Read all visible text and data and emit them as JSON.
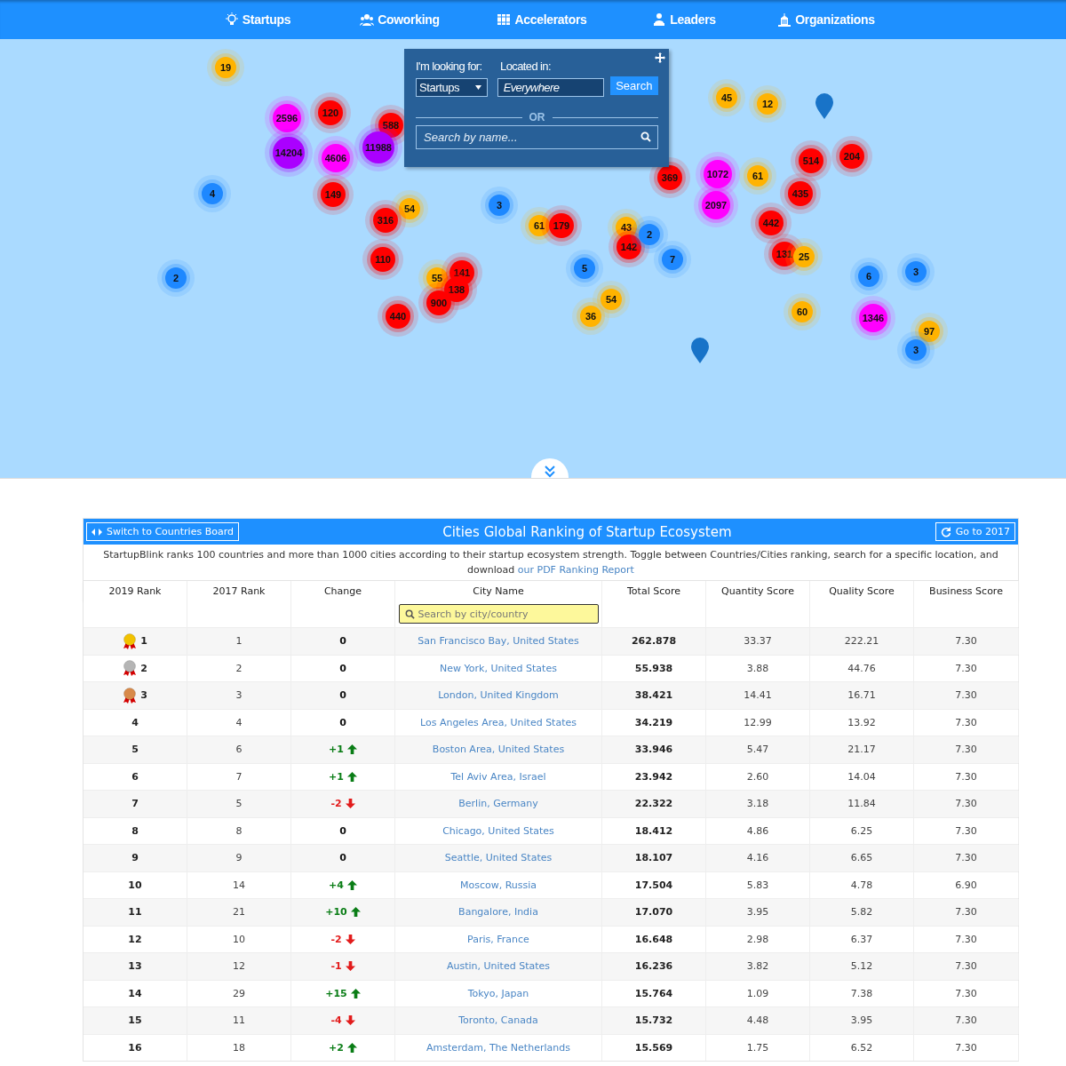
{
  "nav": [
    {
      "label": "Startups"
    },
    {
      "label": "Coworking"
    },
    {
      "label": "Accelerators"
    },
    {
      "label": "Leaders"
    },
    {
      "label": "Organizations"
    }
  ],
  "map": {
    "clusters": [
      {
        "count": "19",
        "color": "#ffb300"
      },
      {
        "count": "2596",
        "color": "#ff00ff"
      },
      {
        "count": "120",
        "color": "#ff0000"
      },
      {
        "count": "588",
        "color": "#ff0000"
      },
      {
        "count": "14204",
        "color": "#aa00ff"
      },
      {
        "count": "4606",
        "color": "#ff00ff"
      },
      {
        "count": "11988",
        "color": "#aa00ff"
      },
      {
        "count": "4",
        "color": "#1e88ff"
      },
      {
        "count": "149",
        "color": "#ff0000"
      },
      {
        "count": "54",
        "color": "#ffb300"
      },
      {
        "count": "316",
        "color": "#ff0000"
      },
      {
        "count": "3",
        "color": "#1e88ff"
      },
      {
        "count": "110",
        "color": "#ff0000"
      },
      {
        "count": "55",
        "color": "#ffb300"
      },
      {
        "count": "141",
        "color": "#ff0000"
      },
      {
        "count": "138",
        "color": "#ff0000"
      },
      {
        "count": "900",
        "color": "#ff0000"
      },
      {
        "count": "440",
        "color": "#ff0000"
      },
      {
        "count": "45",
        "color": "#ffb300"
      },
      {
        "count": "12",
        "color": "#ffb300"
      },
      {
        "count": "369",
        "color": "#ff0000"
      },
      {
        "count": "1072",
        "color": "#ff00ff"
      },
      {
        "count": "2097",
        "color": "#ff00ff"
      },
      {
        "count": "61",
        "color": "#ffb300"
      },
      {
        "count": "514",
        "color": "#ff0000"
      },
      {
        "count": "204",
        "color": "#ff0000"
      },
      {
        "count": "435",
        "color": "#ff0000"
      },
      {
        "count": "442",
        "color": "#ff0000"
      },
      {
        "count": "131",
        "color": "#ff0000"
      },
      {
        "count": "25",
        "color": "#ffb300"
      },
      {
        "count": "61",
        "color": "#ffb300"
      },
      {
        "count": "179",
        "color": "#ff0000"
      },
      {
        "count": "43",
        "color": "#ffb300"
      },
      {
        "count": "142",
        "color": "#ff0000"
      },
      {
        "count": "2",
        "color": "#1e88ff"
      },
      {
        "count": "7",
        "color": "#1e88ff"
      },
      {
        "count": "5",
        "color": "#1e88ff"
      },
      {
        "count": "54",
        "color": "#ffb300"
      },
      {
        "count": "36",
        "color": "#ffb300"
      },
      {
        "count": "60",
        "color": "#ffb300"
      },
      {
        "count": "1346",
        "color": "#ff00ff"
      },
      {
        "count": "6",
        "color": "#1e88ff"
      },
      {
        "count": "3",
        "color": "#1e88ff"
      },
      {
        "count": "97",
        "color": "#ffb300"
      },
      {
        "count": "3",
        "color": "#1e88ff"
      },
      {
        "count": "2",
        "color": "#1e88ff"
      }
    ],
    "search_panel": {
      "looking_for_label": "I'm looking for:",
      "located_in_label": "Located in:",
      "type_select": "Startups",
      "location_value": "Everywhere",
      "search_button": "Search",
      "or_label": "OR",
      "name_search": {
        "placeholder": "Search by name..."
      }
    }
  },
  "ranking": {
    "switch_button": "Switch to Countries Board",
    "title": "Cities Global Ranking of Startup Ecosystem",
    "year_button": "Go to 2017",
    "description": "StartupBlink ranks 100 countries and more than 1000 cities according to their startup ecosystem strength. Toggle between Countries/Cities ranking, search for a specific location, and download",
    "description_link": "our PDF Ranking Report",
    "columns": [
      "2019 Rank",
      "2017 Rank",
      "Change",
      "City Name",
      "Total Score",
      "Quantity Score",
      "Quality Score",
      "Business Score"
    ],
    "city_search": {
      "placeholder": "Search by city/country"
    },
    "rows": [
      {
        "rank": "1",
        "kind": "gold",
        "prev": "1",
        "change": {
          "text": "0",
          "kind": "none"
        },
        "city": "San Francisco Bay, United States",
        "total": "262.878",
        "quantity": "33.37",
        "quality": "222.21",
        "business": "7.30"
      },
      {
        "rank": "2",
        "kind": "silver",
        "prev": "2",
        "change": {
          "text": "0",
          "kind": "none"
        },
        "city": "New York, United States",
        "total": "55.938",
        "quantity": "3.88",
        "quality": "44.76",
        "business": "7.30"
      },
      {
        "rank": "3",
        "kind": "bronze",
        "prev": "3",
        "change": {
          "text": "0",
          "kind": "none"
        },
        "city": "London, United Kingdom",
        "total": "38.421",
        "quantity": "14.41",
        "quality": "16.71",
        "business": "7.30"
      },
      {
        "rank": "4",
        "kind": "plain",
        "prev": "4",
        "change": {
          "text": "0",
          "kind": "none"
        },
        "city": "Los Angeles Area, United States",
        "total": "34.219",
        "quantity": "12.99",
        "quality": "13.92",
        "business": "7.30"
      },
      {
        "rank": "5",
        "kind": "plain",
        "prev": "6",
        "change": {
          "text": "+1",
          "kind": "up"
        },
        "city": "Boston Area, United States",
        "total": "33.946",
        "quantity": "5.47",
        "quality": "21.17",
        "business": "7.30"
      },
      {
        "rank": "6",
        "kind": "plain",
        "prev": "7",
        "change": {
          "text": "+1",
          "kind": "up"
        },
        "city": "Tel Aviv Area, Israel",
        "total": "23.942",
        "quantity": "2.60",
        "quality": "14.04",
        "business": "7.30"
      },
      {
        "rank": "7",
        "kind": "plain",
        "prev": "5",
        "change": {
          "text": "-2",
          "kind": "down"
        },
        "city": "Berlin, Germany",
        "total": "22.322",
        "quantity": "3.18",
        "quality": "11.84",
        "business": "7.30"
      },
      {
        "rank": "8",
        "kind": "plain",
        "prev": "8",
        "change": {
          "text": "0",
          "kind": "none"
        },
        "city": "Chicago, United States",
        "total": "18.412",
        "quantity": "4.86",
        "quality": "6.25",
        "business": "7.30"
      },
      {
        "rank": "9",
        "kind": "plain",
        "prev": "9",
        "change": {
          "text": "0",
          "kind": "none"
        },
        "city": "Seattle, United States",
        "total": "18.107",
        "quantity": "4.16",
        "quality": "6.65",
        "business": "7.30"
      },
      {
        "rank": "10",
        "kind": "plain",
        "prev": "14",
        "change": {
          "text": "+4",
          "kind": "up"
        },
        "city": "Moscow, Russia",
        "total": "17.504",
        "quantity": "5.83",
        "quality": "4.78",
        "business": "6.90"
      },
      {
        "rank": "11",
        "kind": "plain",
        "prev": "21",
        "change": {
          "text": "+10",
          "kind": "up"
        },
        "city": "Bangalore, India",
        "total": "17.070",
        "quantity": "3.95",
        "quality": "5.82",
        "business": "7.30"
      },
      {
        "rank": "12",
        "kind": "plain",
        "prev": "10",
        "change": {
          "text": "-2",
          "kind": "down"
        },
        "city": "Paris, France",
        "total": "16.648",
        "quantity": "2.98",
        "quality": "6.37",
        "business": "7.30"
      },
      {
        "rank": "13",
        "kind": "plain",
        "prev": "12",
        "change": {
          "text": "-1",
          "kind": "down"
        },
        "city": "Austin, United States",
        "total": "16.236",
        "quantity": "3.82",
        "quality": "5.12",
        "business": "7.30"
      },
      {
        "rank": "14",
        "kind": "plain",
        "prev": "29",
        "change": {
          "text": "+15",
          "kind": "up"
        },
        "city": "Tokyo, Japan",
        "total": "15.764",
        "quantity": "1.09",
        "quality": "7.38",
        "business": "7.30"
      },
      {
        "rank": "15",
        "kind": "plain",
        "prev": "11",
        "change": {
          "text": "-4",
          "kind": "down"
        },
        "city": "Toronto, Canada",
        "total": "15.732",
        "quantity": "4.48",
        "quality": "3.95",
        "business": "7.30"
      },
      {
        "rank": "16",
        "kind": "plain",
        "prev": "18",
        "change": {
          "text": "+2",
          "kind": "up"
        },
        "city": "Amsterdam, The Netherlands",
        "total": "15.569",
        "quantity": "1.75",
        "quality": "6.52",
        "business": "7.30"
      }
    ]
  }
}
